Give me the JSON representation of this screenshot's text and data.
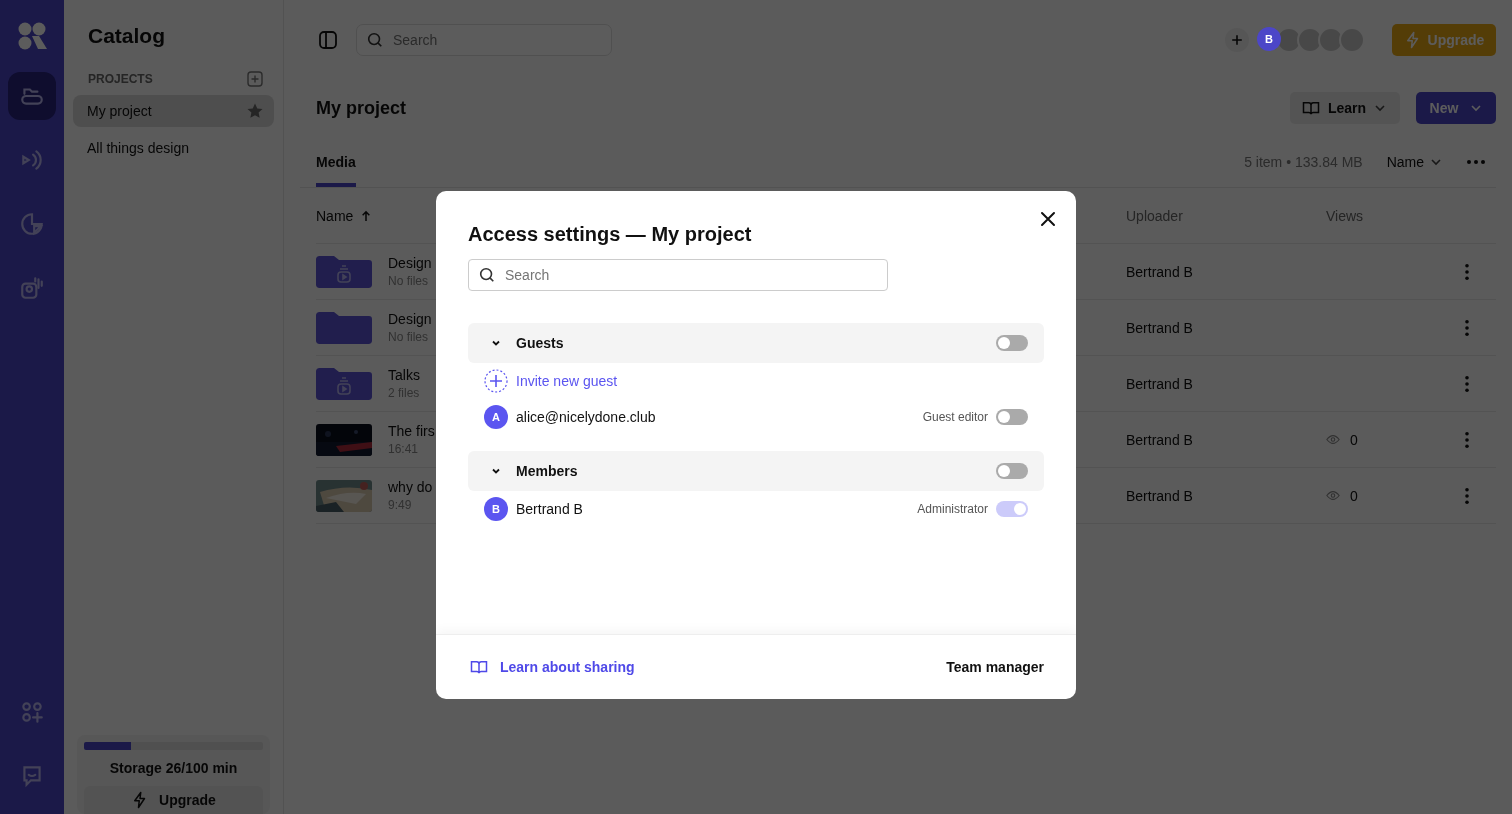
{
  "rail_items": [
    {
      "kind": "folder",
      "selected": true
    },
    {
      "kind": "podcast",
      "selected": false
    },
    {
      "kind": "chart",
      "selected": false
    },
    {
      "kind": "studio",
      "selected": false
    },
    {
      "kind": "apps",
      "selected": false
    },
    {
      "kind": "chat",
      "selected": false
    }
  ],
  "sidebar": {
    "title": "Catalog",
    "section": "PROJECTS",
    "projects": [
      {
        "name": "My project",
        "selected": true,
        "starred": true
      },
      {
        "name": "All things design",
        "selected": false,
        "starred": false
      }
    ],
    "storage": {
      "label": "Storage 26/100 min",
      "level": 0.26
    },
    "upgrade": "Upgrade"
  },
  "topbar": {
    "search": {
      "placeholder": "Search"
    },
    "avatars": [
      {
        "kind": "user",
        "initial": "B"
      },
      {
        "kind": "empty"
      },
      {
        "kind": "empty"
      },
      {
        "kind": "empty"
      },
      {
        "kind": "empty"
      }
    ],
    "upgrade": "Upgrade"
  },
  "page": {
    "title": "My project",
    "learn": "Learn",
    "new": "New",
    "tabs": [
      {
        "label": "Media",
        "selected": true
      }
    ],
    "summary": "5 item • 133.84 MB",
    "sort": "Name"
  },
  "table": {
    "columns": [
      "Name",
      "Uploader",
      "Views"
    ],
    "rows": [
      {
        "kind": "media-folder",
        "name": "Design",
        "meta": "No files",
        "uploader": "Bertrand B"
      },
      {
        "kind": "folder",
        "name": "Design",
        "meta": "No files",
        "uploader": "Bertrand B"
      },
      {
        "kind": "media-folder",
        "name": "Talks",
        "meta": "2 files",
        "uploader": "Bertrand B"
      },
      {
        "kind": "video",
        "name": "The firs",
        "meta": "16:41",
        "uploader": "Bertrand B",
        "views": "0"
      },
      {
        "kind": "video",
        "name": "why do",
        "meta": "9:49",
        "uploader": "Bertrand B",
        "views": "0"
      }
    ]
  },
  "dialog": {
    "title": "Access settings — My project",
    "search": {
      "placeholder": "Search"
    },
    "groups": [
      {
        "title": "Guests",
        "expanded": true,
        "on": false,
        "invite": "Invite new guest",
        "people": [
          {
            "initial": "A",
            "name": "alice@nicelydone.club",
            "role": "Guest editor",
            "on": false,
            "disabled": false
          }
        ]
      },
      {
        "title": "Members",
        "expanded": true,
        "on": false,
        "people": [
          {
            "initial": "B",
            "name": "Bertrand B",
            "role": "Administrator",
            "on": true,
            "disabled": true
          }
        ]
      }
    ],
    "link": "Learn about sharing",
    "button": "Team manager"
  }
}
